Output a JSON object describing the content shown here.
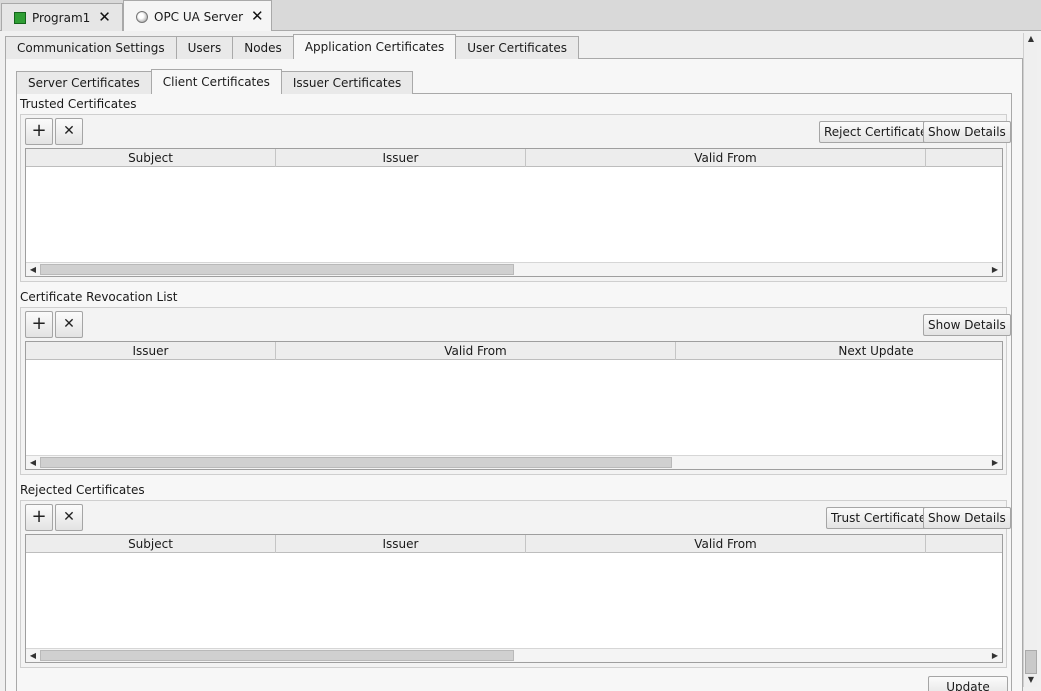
{
  "document_tabs": [
    {
      "label": "Program1",
      "icon": "green-block-icon",
      "close": "✕"
    },
    {
      "label": "OPC UA Server",
      "icon": "server-icon",
      "close": "✕"
    }
  ],
  "main_tabs": [
    "Communication Settings",
    "Users",
    "Nodes",
    "Application Certificates",
    "User Certificates"
  ],
  "sub_tabs": [
    "Server Certificates",
    "Client Certificates",
    "Issuer Certificates"
  ],
  "icons": {
    "add": "+",
    "remove": "✕",
    "scroll_left": "◀",
    "scroll_right": "▶",
    "scroll_up": "▲",
    "scroll_down": "▼"
  },
  "sections": {
    "trusted": {
      "title": "Trusted Certificates",
      "action_button": "Reject Certificate",
      "details_button": "Show Details",
      "columns": [
        "Subject",
        "Issuer",
        "Valid From",
        ""
      ]
    },
    "revocation": {
      "title": "Certificate Revocation List",
      "details_button": "Show Details",
      "columns": [
        "Issuer",
        "Valid From",
        "Next Update"
      ]
    },
    "rejected": {
      "title": "Rejected Certificates",
      "action_button": "Trust Certificate",
      "details_button": "Show Details",
      "columns": [
        "Subject",
        "Issuer",
        "Valid From",
        ""
      ]
    }
  },
  "update_button": "Update"
}
